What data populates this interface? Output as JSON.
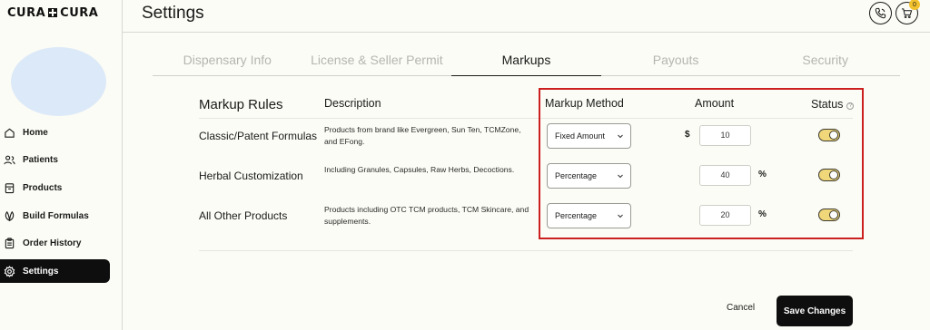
{
  "app": {
    "logo_left": "CURA",
    "logo_right": "CURA"
  },
  "header": {
    "title": "Settings",
    "cart_count": "0"
  },
  "sidebar": {
    "items": [
      {
        "label": "Home",
        "icon": "home-icon"
      },
      {
        "label": "Patients",
        "icon": "users-icon"
      },
      {
        "label": "Products",
        "icon": "box-icon"
      },
      {
        "label": "Build Formulas",
        "icon": "leaf-icon"
      },
      {
        "label": "Order History",
        "icon": "clipboard-icon"
      },
      {
        "label": "Settings",
        "icon": "gear-icon",
        "active": true
      }
    ]
  },
  "tabs": [
    {
      "label": "Dispensary Info"
    },
    {
      "label": "License & Seller Permit"
    },
    {
      "label": "Markups",
      "active": true
    },
    {
      "label": "Payouts"
    },
    {
      "label": "Security"
    }
  ],
  "table": {
    "headers": {
      "rules": "Markup Rules",
      "description": "Description",
      "method": "Markup Method",
      "amount": "Amount",
      "status": "Status",
      "status_help": "?"
    },
    "rows": [
      {
        "category": "Classic/Patent Formulas",
        "description": "Products from brand like Evergreen, Sun Ten, TCMZone, and EFong.",
        "method": "Fixed Amount",
        "prefix": "$",
        "amount": "10",
        "suffix": "",
        "status_on": true
      },
      {
        "category": "Herbal Customization",
        "description": "Including Granules, Capsules, Raw Herbs, Decoctions.",
        "method": "Percentage",
        "prefix": "",
        "amount": "40",
        "suffix": "%",
        "status_on": true
      },
      {
        "category": "All Other Products",
        "description": "Products including OTC TCM products, TCM Skincare, and supplements.",
        "method": "Percentage",
        "prefix": "",
        "amount": "20",
        "suffix": "%",
        "status_on": true
      }
    ]
  },
  "actions": {
    "cancel": "Cancel",
    "save": "Save Changes"
  },
  "colors": {
    "highlight": "#cc1f1f",
    "toggle_on": "#f0d77a",
    "cart_badge": "#f2c12e"
  }
}
